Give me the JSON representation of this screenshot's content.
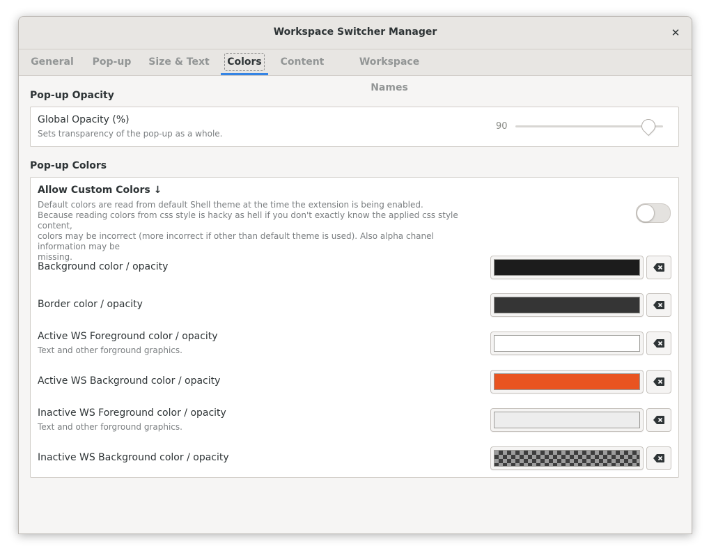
{
  "window": {
    "title": "Workspace Switcher Manager",
    "close_glyph": "✕"
  },
  "tabs": [
    {
      "label": "General"
    },
    {
      "label": "Pop-up"
    },
    {
      "label": "Size & Text"
    },
    {
      "label": "Colors",
      "active": true
    },
    {
      "label": "Content"
    },
    {
      "label": "Workspace Names"
    }
  ],
  "opacity_section": {
    "title": "Pop-up Opacity",
    "global_opacity": {
      "label": "Global Opacity (%)",
      "description": "Sets transparency of the pop-up as a whole.",
      "value": "90",
      "fraction": 0.9
    }
  },
  "colors_section": {
    "title": "Pop-up Colors",
    "allow_custom": {
      "label": "Allow Custom Colors ↓",
      "description_lines": [
        "Default colors are read from default Shell theme at the time the extension is being enabled.",
        "Because reading colors from css style is hacky as hell if you don't exactly know the applied css style content,",
        "colors may be incorrect (more incorrect if other than default theme is used). Also alpha chanel information may be",
        "missing."
      ],
      "enabled": false
    },
    "rows": [
      {
        "label": "Background color / opacity",
        "color": "#1c1c1c",
        "icon": "backspace-icon"
      },
      {
        "label": "Border color / opacity",
        "color": "#353535",
        "icon": "backspace-icon"
      },
      {
        "label": "Active WS Foreground color / opacity",
        "description": "Text and other forground graphics.",
        "color": "#ffffff",
        "icon": "backspace-icon"
      },
      {
        "label": "Active WS Background color  / opacity",
        "color": "#e95420",
        "icon": "backspace-icon"
      },
      {
        "label": "Inactive WS Foreground color / opacity",
        "description": "Text and other forground graphics.",
        "color": "#ededed",
        "icon": "backspace-icon"
      },
      {
        "label": "Inactive WS Background color  / opacity",
        "color": "transparent",
        "icon": "backspace-icon"
      }
    ]
  },
  "colors": {
    "accent": "#3584e4",
    "toggle_off": "#e4e2df"
  }
}
